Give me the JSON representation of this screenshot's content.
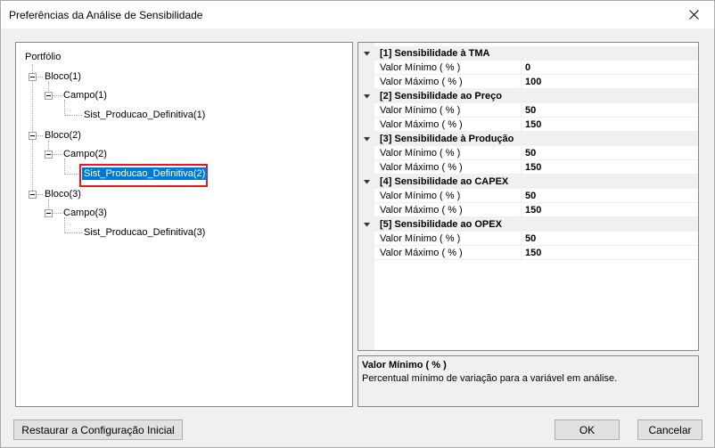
{
  "window": {
    "title": "Preferências da Análise de Sensibilidade"
  },
  "tree": {
    "root": "Portfólio",
    "nodes": [
      {
        "label": "Bloco(1)"
      },
      {
        "label": "Campo(1)"
      },
      {
        "label": "Sist_Producao_Definitiva(1)"
      },
      {
        "label": "Bloco(2)"
      },
      {
        "label": "Campo(2)"
      },
      {
        "label": "Sist_Producao_Definitiva(2)"
      },
      {
        "label": "Bloco(3)"
      },
      {
        "label": "Campo(3)"
      },
      {
        "label": "Sist_Producao_Definitiva(3)"
      }
    ],
    "selected": "Sist_Producao_Definitiva(2)"
  },
  "properties": {
    "categories": [
      {
        "title": "[1] Sensibilidade à TMA",
        "rows": [
          {
            "name": "Valor Mínimo ( % )",
            "value": "0"
          },
          {
            "name": "Valor Máximo ( % )",
            "value": "100"
          }
        ]
      },
      {
        "title": "[2] Sensibilidade ao Preço",
        "rows": [
          {
            "name": "Valor Mínimo ( % )",
            "value": "50"
          },
          {
            "name": "Valor Máximo ( % )",
            "value": "150"
          }
        ]
      },
      {
        "title": "[3] Sensibilidade à Produção",
        "rows": [
          {
            "name": "Valor Mínimo ( % )",
            "value": "50"
          },
          {
            "name": "Valor Máximo ( % )",
            "value": "150"
          }
        ]
      },
      {
        "title": "[4] Sensibilidade ao CAPEX",
        "rows": [
          {
            "name": "Valor Mínimo ( % )",
            "value": "50"
          },
          {
            "name": "Valor Máximo ( % )",
            "value": "150"
          }
        ]
      },
      {
        "title": "[5] Sensibilidade ao OPEX",
        "rows": [
          {
            "name": "Valor Mínimo ( % )",
            "value": "50"
          },
          {
            "name": "Valor Máximo ( % )",
            "value": "150"
          }
        ]
      }
    ]
  },
  "description": {
    "title": "Valor Mínimo ( % )",
    "text": "Percentual mínimo de variação para a variável em análise."
  },
  "buttons": {
    "reset": "Restaurar a Configuração Inicial",
    "ok": "OK",
    "cancel": "Cancelar"
  },
  "icons": {
    "close": "close-icon",
    "collapse": "minus-icon",
    "expander": "tree-collapse-icon"
  },
  "colors": {
    "selection": "#0078d7",
    "highlight_box": "#e8191f"
  }
}
